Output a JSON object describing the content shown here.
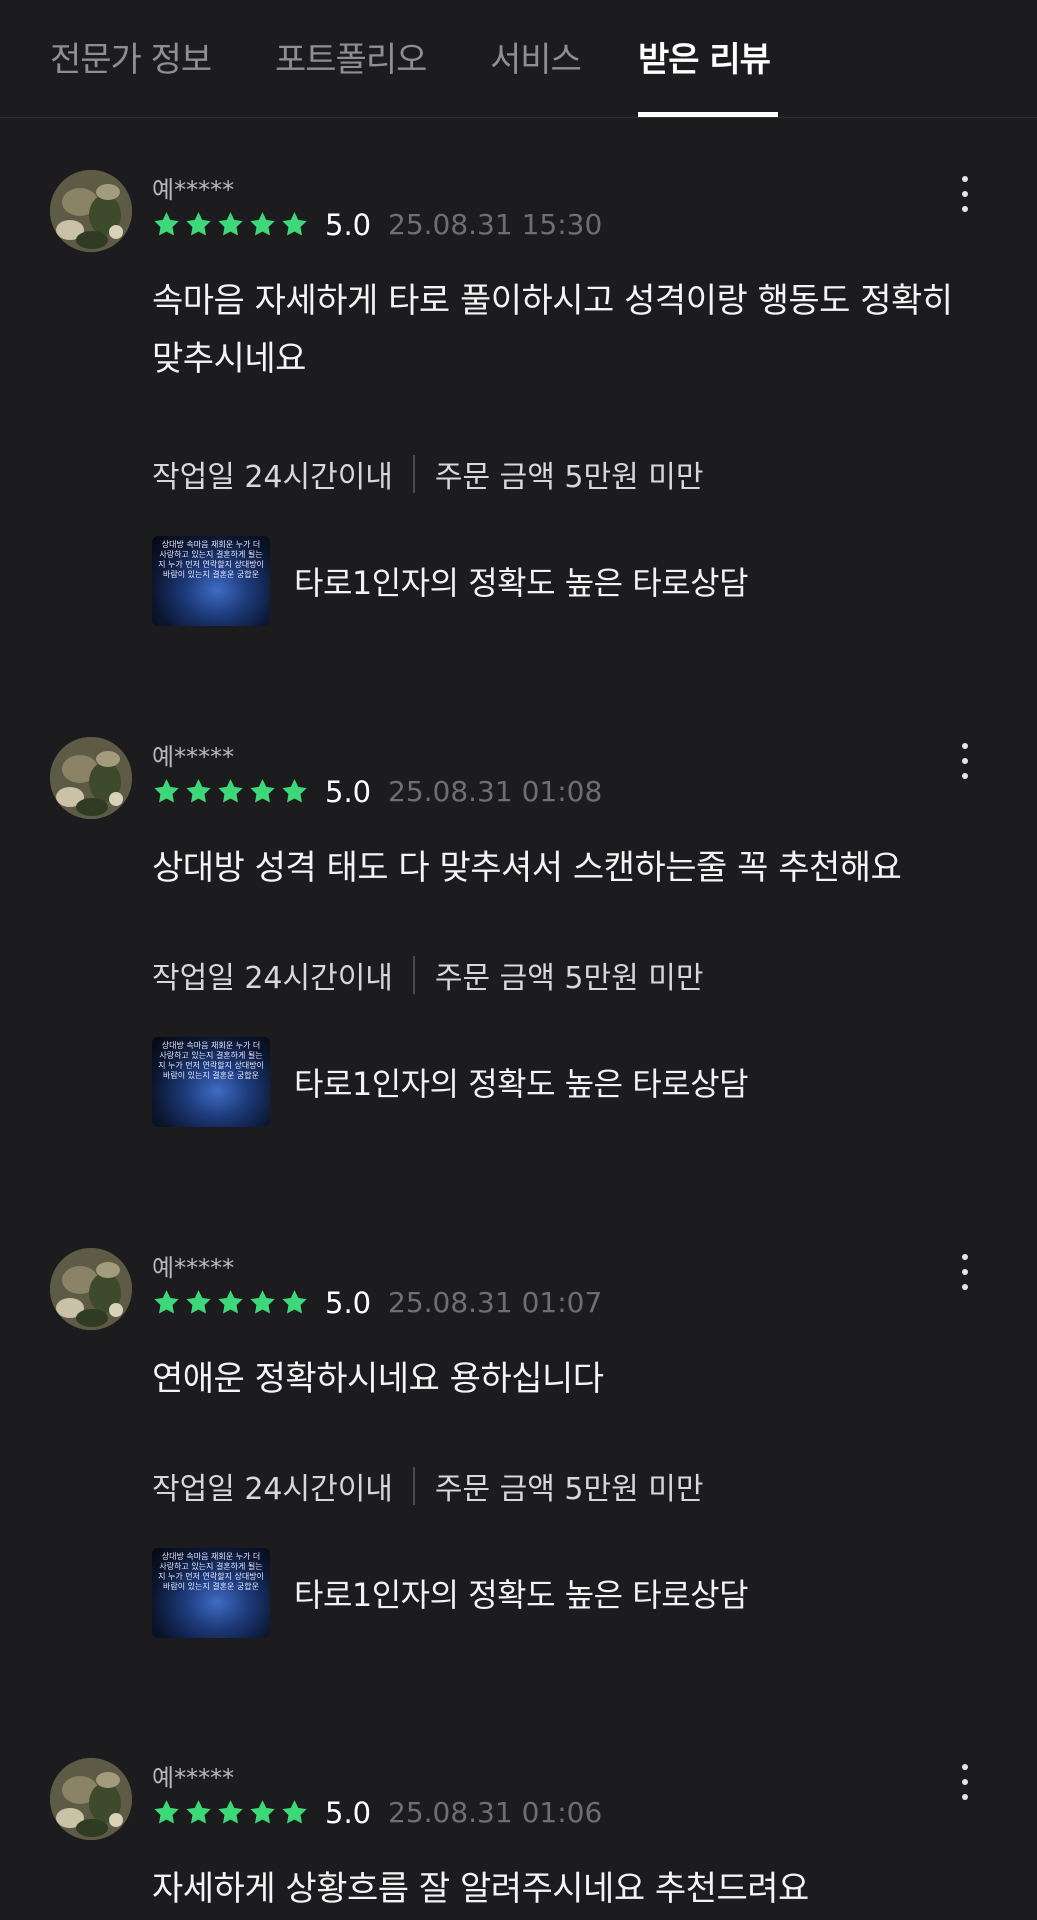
{
  "tabs": [
    {
      "label": "전문가 정보",
      "active": false
    },
    {
      "label": "포트폴리오",
      "active": false
    },
    {
      "label": "서비스",
      "active": false
    },
    {
      "label": "받은 리뷰",
      "active": true
    }
  ],
  "colors": {
    "star": "#3dd87a",
    "background": "#1c1c1e"
  },
  "reviews": [
    {
      "username": "예*****",
      "rating": "5.0",
      "stars": 5,
      "date": "25.08.31 15:30",
      "content": "속마음 자세하게 타로 풀이하시고 성격이랑 행동도 정확히 맞추시네요",
      "work_days": "작업일 24시간이내",
      "order_amount": "주문 금액 5만원 미만",
      "service_title": "타로1인자의 정확도 높은 타로상담",
      "thumb_text": "상대방 속마음 재회운 누가 더 사랑하고 있는지 결혼하게 될는지 누가 먼저 연락할지 상대방이 바람이 있는지 결혼운 궁합운"
    },
    {
      "username": "예*****",
      "rating": "5.0",
      "stars": 5,
      "date": "25.08.31 01:08",
      "content": "상대방 성격 태도 다 맞추셔서 스캔하는줄 꼭 추천해요",
      "work_days": "작업일 24시간이내",
      "order_amount": "주문 금액 5만원 미만",
      "service_title": "타로1인자의 정확도 높은 타로상담",
      "thumb_text": "상대방 속마음 재회운 누가 더 사랑하고 있는지 결혼하게 될는지 누가 먼저 연락할지 상대방이 바람이 있는지 결혼운 궁합운"
    },
    {
      "username": "예*****",
      "rating": "5.0",
      "stars": 5,
      "date": "25.08.31 01:07",
      "content": "연애운 정확하시네요 용하십니다",
      "work_days": "작업일 24시간이내",
      "order_amount": "주문 금액 5만원 미만",
      "service_title": "타로1인자의 정확도 높은 타로상담",
      "thumb_text": "상대방 속마음 재회운 누가 더 사랑하고 있는지 결혼하게 될는지 누가 먼저 연락할지 상대방이 바람이 있는지 결혼운 궁합운"
    },
    {
      "username": "예*****",
      "rating": "5.0",
      "stars": 5,
      "date": "25.08.31 01:06",
      "content": "자세하게 상황흐름 잘 알려주시네요 추천드려요"
    }
  ]
}
